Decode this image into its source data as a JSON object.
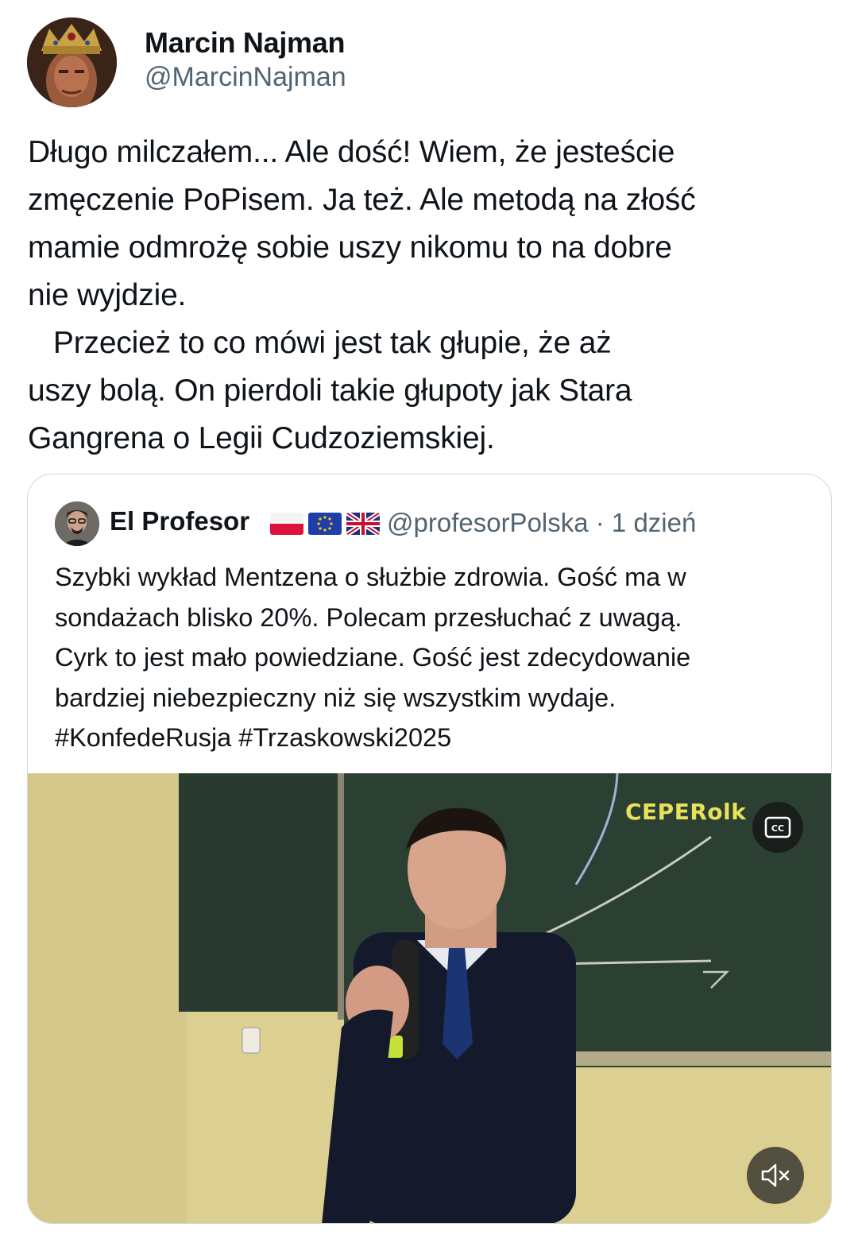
{
  "author": {
    "name": "Marcin Najman",
    "handle": "@MarcinNajman"
  },
  "tweet": {
    "text": "Długo milczałem... Ale dość! Wiem, że jesteście\nzmęczenie PoPisem. Ja też. Ale metodą na złość\nmamie odmrożę sobie uszy nikomu to na dobre\nnie wyjdzie.\n   Przecież to co mówi jest tak głupie, że aż\nuszy bolą. On pierdoli takie głupoty jak Stara\nGangrena o Legii Cudzoziemskiej."
  },
  "quote": {
    "name": "El Profesor",
    "flags": [
      "flag-poland-icon",
      "flag-eu-icon",
      "flag-uk-icon"
    ],
    "handle_time": "@profesorPolska · 1 dzień",
    "text": "Szybki wykład Mentzena o służbie zdrowia. Gość ma w\nsondażach blisko 20%. Polecam przesłuchać z uwagą.\nCyrk to jest mało powiedziane. Gość jest zdecydowanie\nbardziej niebezpieczny niż się wszystkim wydaje.\n#KonfedeRusja #Trzaskowski2025",
    "video": {
      "watermark": "CEPERolk",
      "cc_label": "CC",
      "controls": [
        "cc-icon",
        "mute-icon"
      ]
    }
  },
  "colors": {
    "text": "#0f1419",
    "secondary": "#536471",
    "border": "#cfd9de"
  }
}
